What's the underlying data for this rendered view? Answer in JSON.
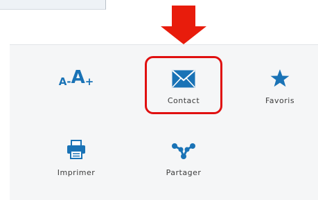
{
  "toolbar": {
    "font_size": {
      "decrease": "A",
      "dash": "-",
      "increase": "A",
      "plus": "+"
    },
    "contact_label": "Contact",
    "favoris_label": "Favoris",
    "imprimer_label": "Imprimer",
    "partager_label": "Partager"
  },
  "colors": {
    "accent": "#1a73b6",
    "highlight": "#e01010",
    "arrow": "#e81c0c"
  },
  "icons": [
    "font-size-icon",
    "envelope-icon",
    "star-icon",
    "printer-icon",
    "share-icon",
    "down-arrow-icon"
  ]
}
